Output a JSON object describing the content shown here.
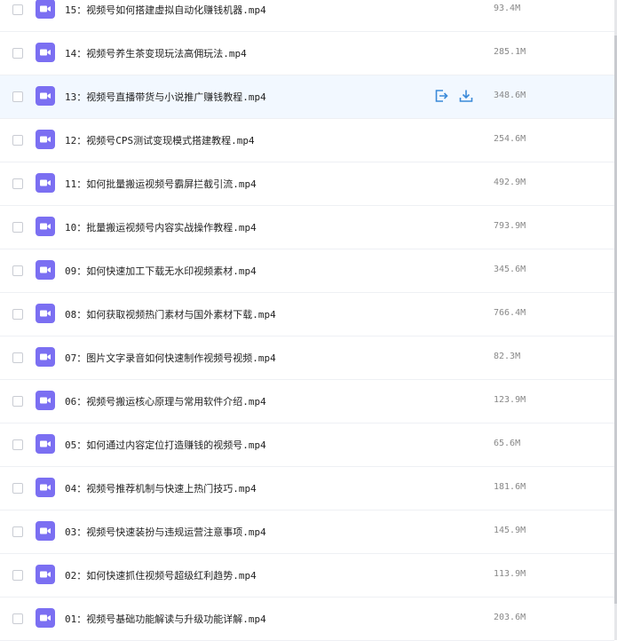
{
  "files": [
    {
      "name": "15：视频号如何搭建虚拟自动化赚钱机器.mp4",
      "size": "93.4M"
    },
    {
      "name": "14：视频号养生茶变现玩法高佣玩法.mp4",
      "size": "285.1M"
    },
    {
      "name": "13：视频号直播带货与小说推广赚钱教程.mp4",
      "size": "348.6M"
    },
    {
      "name": "12：视频号CPS测试变现模式搭建教程.mp4",
      "size": "254.6M"
    },
    {
      "name": "11：如何批量搬运视频号霸屏拦截引流.mp4",
      "size": "492.9M"
    },
    {
      "name": "10：批量搬运视频号内容实战操作教程.mp4",
      "size": "793.9M"
    },
    {
      "name": "09：如何快速加工下载无水印视频素材.mp4",
      "size": "345.6M"
    },
    {
      "name": "08：如何获取视频热门素材与国外素材下载.mp4",
      "size": "766.4M"
    },
    {
      "name": "07：图片文字录音如何快速制作视频号视频.mp4",
      "size": "82.3M"
    },
    {
      "name": "06：视频号搬运核心原理与常用软件介绍.mp4",
      "size": "123.9M"
    },
    {
      "name": "05：如何通过内容定位打造赚钱的视频号.mp4",
      "size": "65.6M"
    },
    {
      "name": "04：视频号推荐机制与快速上热门技巧.mp4",
      "size": "181.6M"
    },
    {
      "name": "03：视频号快速装扮与违规运营注意事项.mp4",
      "size": "145.9M"
    },
    {
      "name": "02：如何快速抓住视频号超级红利趋势.mp4",
      "size": "113.9M"
    },
    {
      "name": "01：视频号基础功能解读与升级功能详解.mp4",
      "size": "203.6M"
    }
  ],
  "hovered_index": 2,
  "colors": {
    "video_icon": "#7b6ff2",
    "action_icon": "#3b8ad9",
    "hover_row": "#f2f8ff"
  },
  "icons": {
    "file": "video-file-icon",
    "share": "share-icon",
    "download": "download-icon"
  }
}
